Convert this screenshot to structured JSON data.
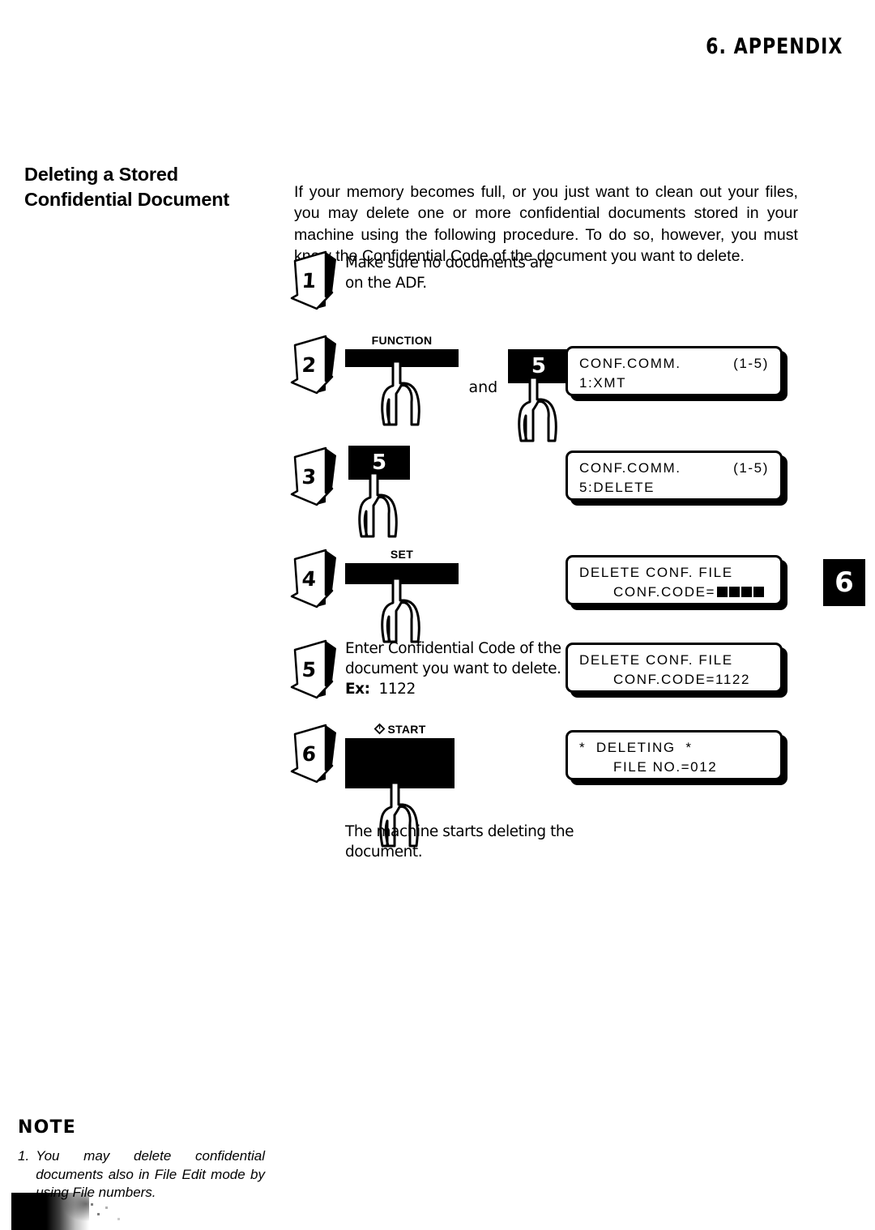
{
  "header": {
    "chapter_title": "6.  APPENDIX",
    "chapter_tab_number": "6"
  },
  "section": {
    "heading_line1": "Deleting a Stored",
    "heading_line2": "Confidential Document",
    "intro": "If your memory becomes full, or you just want to clean out your files, you may delete one or more confidential documents stored in your machine using the following procedure. To do so, however, you must know the Confidential Code of the document you want to delete."
  },
  "steps": [
    {
      "number": "1",
      "text_line1": "Make sure no documents are",
      "text_line2": "on the ADF."
    },
    {
      "number": "2",
      "keys": [
        {
          "label": "FUNCTION",
          "type": "bar",
          "glyph": ""
        },
        {
          "label": "",
          "type": "conjunction",
          "glyph": "and"
        },
        {
          "label": "",
          "type": "numeric",
          "glyph": "5"
        }
      ],
      "display": {
        "line1_left": "CONF.COMM.",
        "line1_right": "(1-5)",
        "line2": "1:XMT"
      }
    },
    {
      "number": "3",
      "keys": [
        {
          "label": "",
          "type": "numeric",
          "glyph": "5"
        }
      ],
      "display": {
        "line1_left": "CONF.COMM.",
        "line1_right": "(1-5)",
        "line2": "5:DELETE"
      }
    },
    {
      "number": "4",
      "keys": [
        {
          "label": "SET",
          "type": "bar",
          "glyph": ""
        }
      ],
      "display": {
        "line1_left": "DELETE CONF. FILE",
        "line1_right": "",
        "line2": "CONF.CODE=",
        "line2_blocks": 4
      }
    },
    {
      "number": "5",
      "text_line1": "Enter Confidential Code of the",
      "text_line2": "document you want to delete.",
      "example_label": "Ex:",
      "example_value": "1122",
      "display": {
        "line1_left": "DELETE CONF. FILE",
        "line1_right": "",
        "line2": "CONF.CODE=1122"
      }
    },
    {
      "number": "6",
      "keys": [
        {
          "label": "START",
          "type": "start",
          "glyph": ""
        }
      ],
      "display": {
        "line1_left": "*  DELETING  *",
        "line1_right": "",
        "line2": "FILE NO.=012"
      },
      "result_line1": "The machine starts deleting the",
      "result_line2": "document."
    }
  ],
  "note": {
    "heading": "NOTE",
    "items": [
      {
        "marker": "1.",
        "text": "You may delete confidential documents also in File Edit mode by using File numbers."
      }
    ]
  },
  "colors": {
    "ink": "#000000",
    "paper": "#ffffff"
  }
}
